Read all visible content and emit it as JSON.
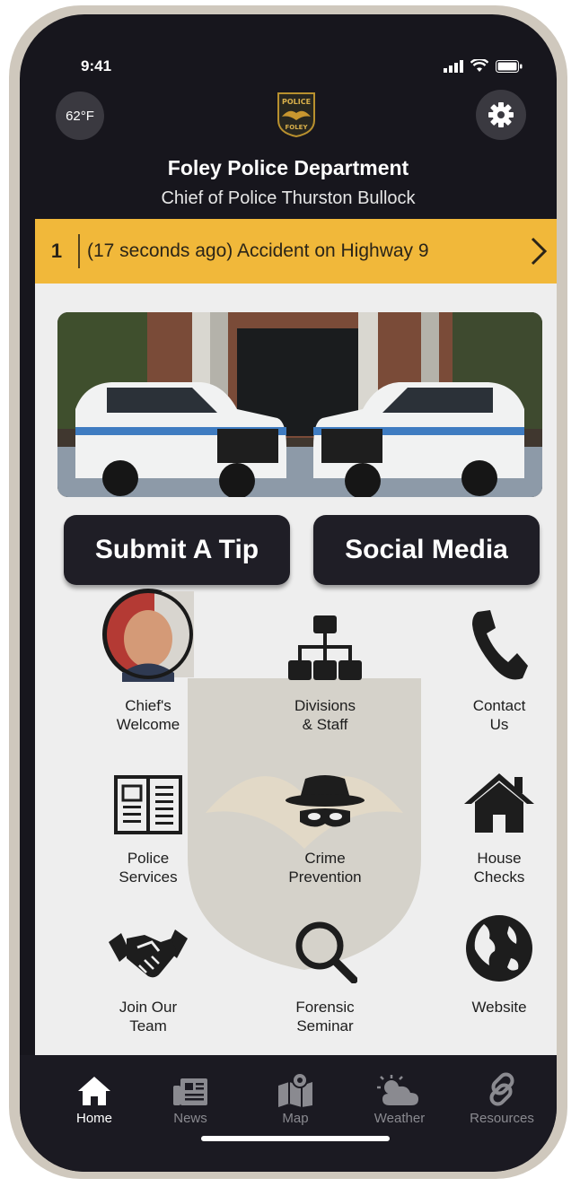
{
  "status_bar": {
    "time": "9:41"
  },
  "header": {
    "temperature": "62°F",
    "title": "Foley Police Department",
    "subtitle": "Chief of Police Thurston Bullock",
    "badge_text_top": "POLICE",
    "badge_text_bottom": "FOLEY"
  },
  "alert": {
    "count": "1",
    "message": "(17 seconds ago) Accident on Highway 9"
  },
  "buttons": {
    "tip": "Submit A Tip",
    "social": "Social Media"
  },
  "grid": [
    {
      "label": "Chief's\nWelcome",
      "icon": "chief-photo"
    },
    {
      "label": "Divisions\n& Staff",
      "icon": "org-chart-icon"
    },
    {
      "label": "Contact\nUs",
      "icon": "phone-icon"
    },
    {
      "label": "Police\nServices",
      "icon": "newspaper-icon"
    },
    {
      "label": "Crime\nPrevention",
      "icon": "incognito-icon"
    },
    {
      "label": "House\nChecks",
      "icon": "house-icon"
    },
    {
      "label": "Join Our\nTeam",
      "icon": "handshake-icon"
    },
    {
      "label": "Forensic\nSeminar",
      "icon": "magnifier-icon"
    },
    {
      "label": "Website",
      "icon": "globe-icon"
    }
  ],
  "tabs": [
    {
      "label": "Home",
      "icon": "home-icon",
      "active": true
    },
    {
      "label": "News",
      "icon": "news-icon"
    },
    {
      "label": "Map",
      "icon": "map-icon"
    },
    {
      "label": "Weather",
      "icon": "weather-icon"
    },
    {
      "label": "Resources",
      "icon": "link-icon"
    }
  ],
  "colors": {
    "accent": "#f1b83a",
    "dark": "#1f1e26",
    "background": "#eeeeee"
  }
}
